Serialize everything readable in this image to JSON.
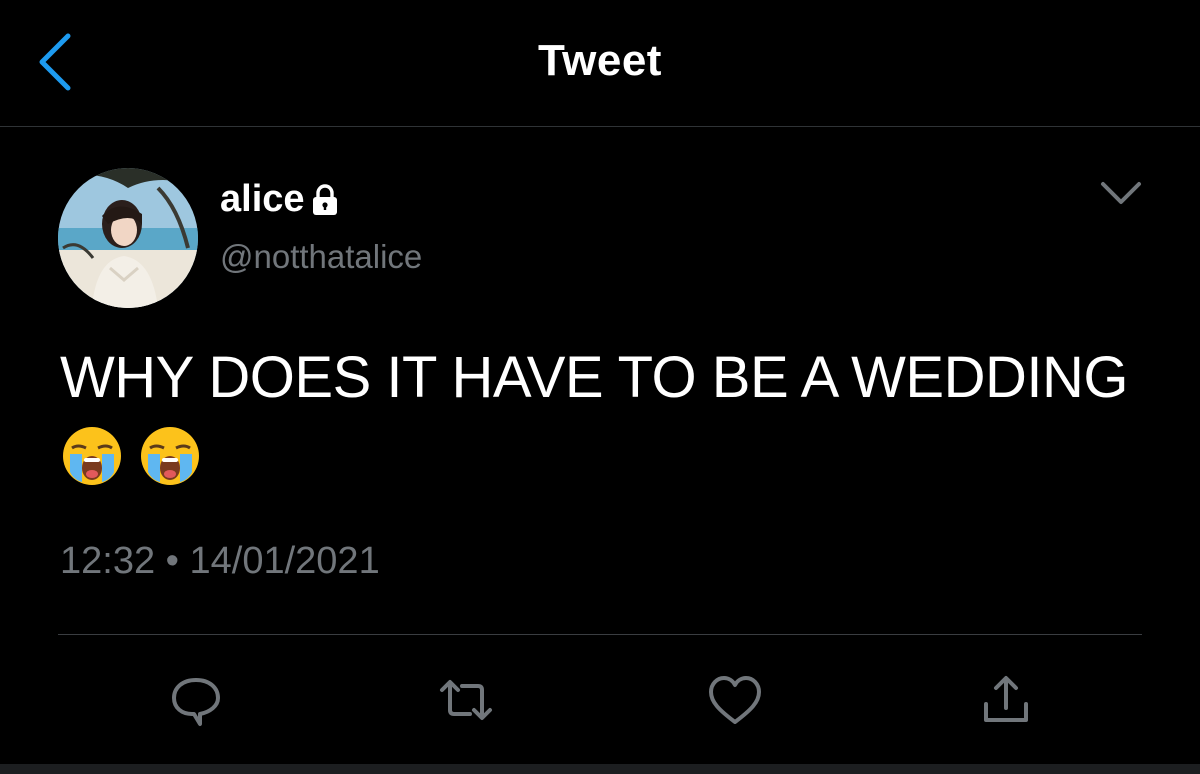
{
  "header": {
    "title": "Tweet"
  },
  "tweet": {
    "author": {
      "display_name": "alice",
      "handle": "@notthatalice",
      "protected": true
    },
    "text": "WHY DOES IT HAVE TO BE A WEDDING",
    "emojis": [
      "😭",
      "😭"
    ],
    "timestamp": "12:32 • 14/01/2021"
  },
  "icons": {
    "back": "chevron-left-icon",
    "lock": "lock-icon",
    "menu": "chevron-down-icon",
    "reply": "reply-icon",
    "retweet": "retweet-icon",
    "like": "heart-icon",
    "share": "share-icon"
  },
  "colors": {
    "background": "#000000",
    "accent": "#1d9bf0",
    "secondary_text": "#71767b",
    "divider": "#2f3336"
  }
}
